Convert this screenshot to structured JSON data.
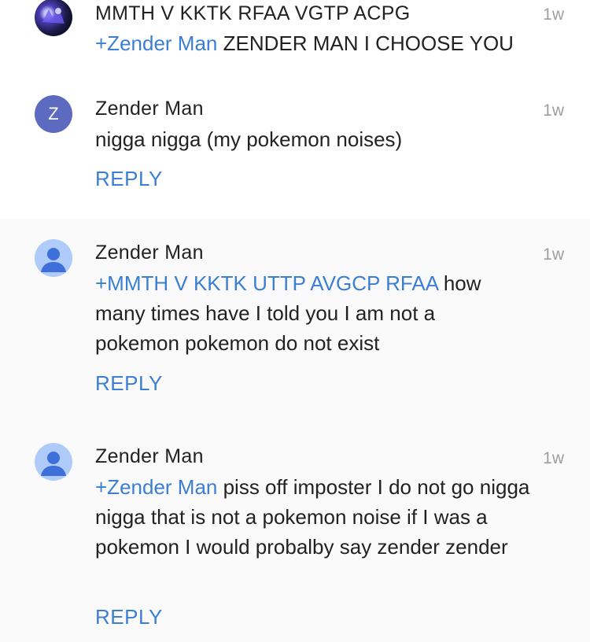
{
  "comments": [
    {
      "author": "MMTH V KKTK RFAA VGTP ACPG",
      "time": "1w",
      "mention": "+Zender Man",
      "text": " ZENDER MAN I CHOOSE YOU",
      "avatar": "photo-avatar"
    },
    {
      "author": "Zender Man",
      "avatar_letter": "Z",
      "time": "1w",
      "text": "nigga nigga (my pokemon noises)",
      "reply_label": "REPLY"
    },
    {
      "author": "Zender Man",
      "avatar": "person-icon",
      "time": "1w",
      "mention": "+MMTH V KKTK UTTP AVGCP RFAA",
      "text": " how many times have I told you I am not a pokemon pokemon do not exist",
      "reply_label": "REPLY"
    },
    {
      "author": "Zender Man",
      "avatar": "person-icon",
      "time": "1w",
      "mention": "+Zender Man",
      "text": " piss off imposter I do not go nigga nigga that is not a pokemon noise if I was a pokemon I would probalby say zender zender",
      "reply_label": "REPLY"
    }
  ],
  "colors": {
    "link": "#3b7fd4",
    "letter_avatar": "#5c6bc0",
    "person_avatar": "#aecbfa",
    "person_icon": "#3f6fd8"
  }
}
